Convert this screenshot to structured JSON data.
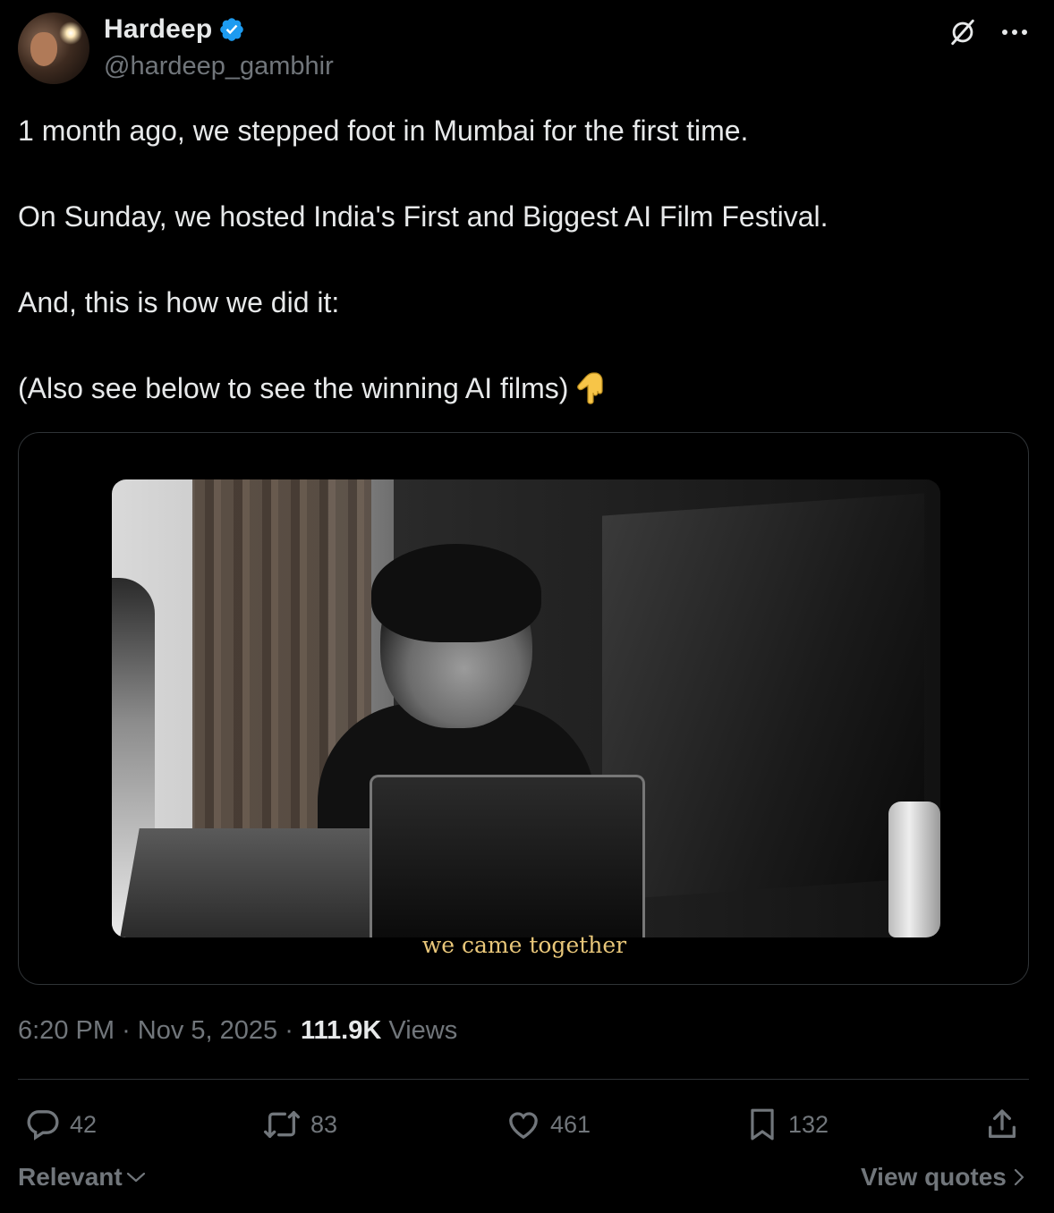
{
  "author": {
    "display_name": "Hardeep",
    "handle": "@hardeep_gambhir",
    "verified": true
  },
  "header_actions": {
    "grok_icon": "grok-icon",
    "more_icon": "more-icon"
  },
  "tweet": {
    "lines": [
      "1 month ago, we stepped foot in Mumbai for the first time.",
      "On Sunday, we hosted India's First and Biggest AI Film Festival.",
      "And, this is how we did it:",
      "(Also see below to see the winning AI films)"
    ],
    "emoji": "👇"
  },
  "media": {
    "caption": "we came together"
  },
  "meta": {
    "time": "6:20 PM",
    "separator": "·",
    "date": "Nov 5, 2025",
    "views_count": "111.9K",
    "views_label": "Views"
  },
  "actions": {
    "replies": "42",
    "reposts": "83",
    "likes": "461",
    "bookmarks": "132"
  },
  "footer": {
    "sort_label": "Relevant",
    "view_quotes": "View quotes"
  },
  "colors": {
    "background": "#000000",
    "text_primary": "#e7e9ea",
    "text_secondary": "#71767b",
    "verified_blue": "#1d9bf0",
    "border": "#2f3336",
    "caption_gold": "#e9c77a"
  }
}
